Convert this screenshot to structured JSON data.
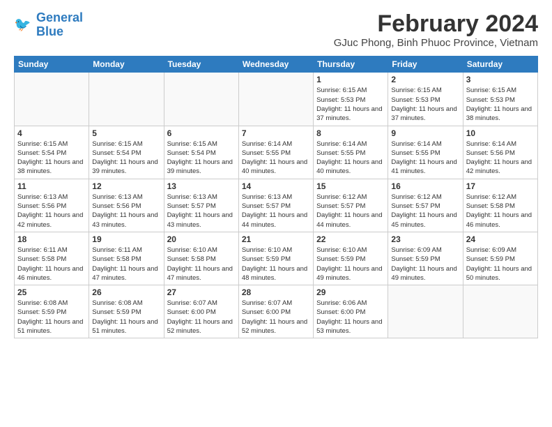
{
  "logo": {
    "line1": "General",
    "line2": "Blue"
  },
  "title": "February 2024",
  "subtitle": "GJuc Phong, Binh Phuoc Province, Vietnam",
  "weekdays": [
    "Sunday",
    "Monday",
    "Tuesday",
    "Wednesday",
    "Thursday",
    "Friday",
    "Saturday"
  ],
  "weeks": [
    [
      {
        "day": "",
        "info": ""
      },
      {
        "day": "",
        "info": ""
      },
      {
        "day": "",
        "info": ""
      },
      {
        "day": "",
        "info": ""
      },
      {
        "day": "1",
        "info": "Sunrise: 6:15 AM\nSunset: 5:53 PM\nDaylight: 11 hours and 37 minutes."
      },
      {
        "day": "2",
        "info": "Sunrise: 6:15 AM\nSunset: 5:53 PM\nDaylight: 11 hours and 37 minutes."
      },
      {
        "day": "3",
        "info": "Sunrise: 6:15 AM\nSunset: 5:53 PM\nDaylight: 11 hours and 38 minutes."
      }
    ],
    [
      {
        "day": "4",
        "info": "Sunrise: 6:15 AM\nSunset: 5:54 PM\nDaylight: 11 hours and 38 minutes."
      },
      {
        "day": "5",
        "info": "Sunrise: 6:15 AM\nSunset: 5:54 PM\nDaylight: 11 hours and 39 minutes."
      },
      {
        "day": "6",
        "info": "Sunrise: 6:15 AM\nSunset: 5:54 PM\nDaylight: 11 hours and 39 minutes."
      },
      {
        "day": "7",
        "info": "Sunrise: 6:14 AM\nSunset: 5:55 PM\nDaylight: 11 hours and 40 minutes."
      },
      {
        "day": "8",
        "info": "Sunrise: 6:14 AM\nSunset: 5:55 PM\nDaylight: 11 hours and 40 minutes."
      },
      {
        "day": "9",
        "info": "Sunrise: 6:14 AM\nSunset: 5:55 PM\nDaylight: 11 hours and 41 minutes."
      },
      {
        "day": "10",
        "info": "Sunrise: 6:14 AM\nSunset: 5:56 PM\nDaylight: 11 hours and 42 minutes."
      }
    ],
    [
      {
        "day": "11",
        "info": "Sunrise: 6:13 AM\nSunset: 5:56 PM\nDaylight: 11 hours and 42 minutes."
      },
      {
        "day": "12",
        "info": "Sunrise: 6:13 AM\nSunset: 5:56 PM\nDaylight: 11 hours and 43 minutes."
      },
      {
        "day": "13",
        "info": "Sunrise: 6:13 AM\nSunset: 5:57 PM\nDaylight: 11 hours and 43 minutes."
      },
      {
        "day": "14",
        "info": "Sunrise: 6:13 AM\nSunset: 5:57 PM\nDaylight: 11 hours and 44 minutes."
      },
      {
        "day": "15",
        "info": "Sunrise: 6:12 AM\nSunset: 5:57 PM\nDaylight: 11 hours and 44 minutes."
      },
      {
        "day": "16",
        "info": "Sunrise: 6:12 AM\nSunset: 5:57 PM\nDaylight: 11 hours and 45 minutes."
      },
      {
        "day": "17",
        "info": "Sunrise: 6:12 AM\nSunset: 5:58 PM\nDaylight: 11 hours and 46 minutes."
      }
    ],
    [
      {
        "day": "18",
        "info": "Sunrise: 6:11 AM\nSunset: 5:58 PM\nDaylight: 11 hours and 46 minutes."
      },
      {
        "day": "19",
        "info": "Sunrise: 6:11 AM\nSunset: 5:58 PM\nDaylight: 11 hours and 47 minutes."
      },
      {
        "day": "20",
        "info": "Sunrise: 6:10 AM\nSunset: 5:58 PM\nDaylight: 11 hours and 47 minutes."
      },
      {
        "day": "21",
        "info": "Sunrise: 6:10 AM\nSunset: 5:59 PM\nDaylight: 11 hours and 48 minutes."
      },
      {
        "day": "22",
        "info": "Sunrise: 6:10 AM\nSunset: 5:59 PM\nDaylight: 11 hours and 49 minutes."
      },
      {
        "day": "23",
        "info": "Sunrise: 6:09 AM\nSunset: 5:59 PM\nDaylight: 11 hours and 49 minutes."
      },
      {
        "day": "24",
        "info": "Sunrise: 6:09 AM\nSunset: 5:59 PM\nDaylight: 11 hours and 50 minutes."
      }
    ],
    [
      {
        "day": "25",
        "info": "Sunrise: 6:08 AM\nSunset: 5:59 PM\nDaylight: 11 hours and 51 minutes."
      },
      {
        "day": "26",
        "info": "Sunrise: 6:08 AM\nSunset: 5:59 PM\nDaylight: 11 hours and 51 minutes."
      },
      {
        "day": "27",
        "info": "Sunrise: 6:07 AM\nSunset: 6:00 PM\nDaylight: 11 hours and 52 minutes."
      },
      {
        "day": "28",
        "info": "Sunrise: 6:07 AM\nSunset: 6:00 PM\nDaylight: 11 hours and 52 minutes."
      },
      {
        "day": "29",
        "info": "Sunrise: 6:06 AM\nSunset: 6:00 PM\nDaylight: 11 hours and 53 minutes."
      },
      {
        "day": "",
        "info": ""
      },
      {
        "day": "",
        "info": ""
      }
    ]
  ]
}
